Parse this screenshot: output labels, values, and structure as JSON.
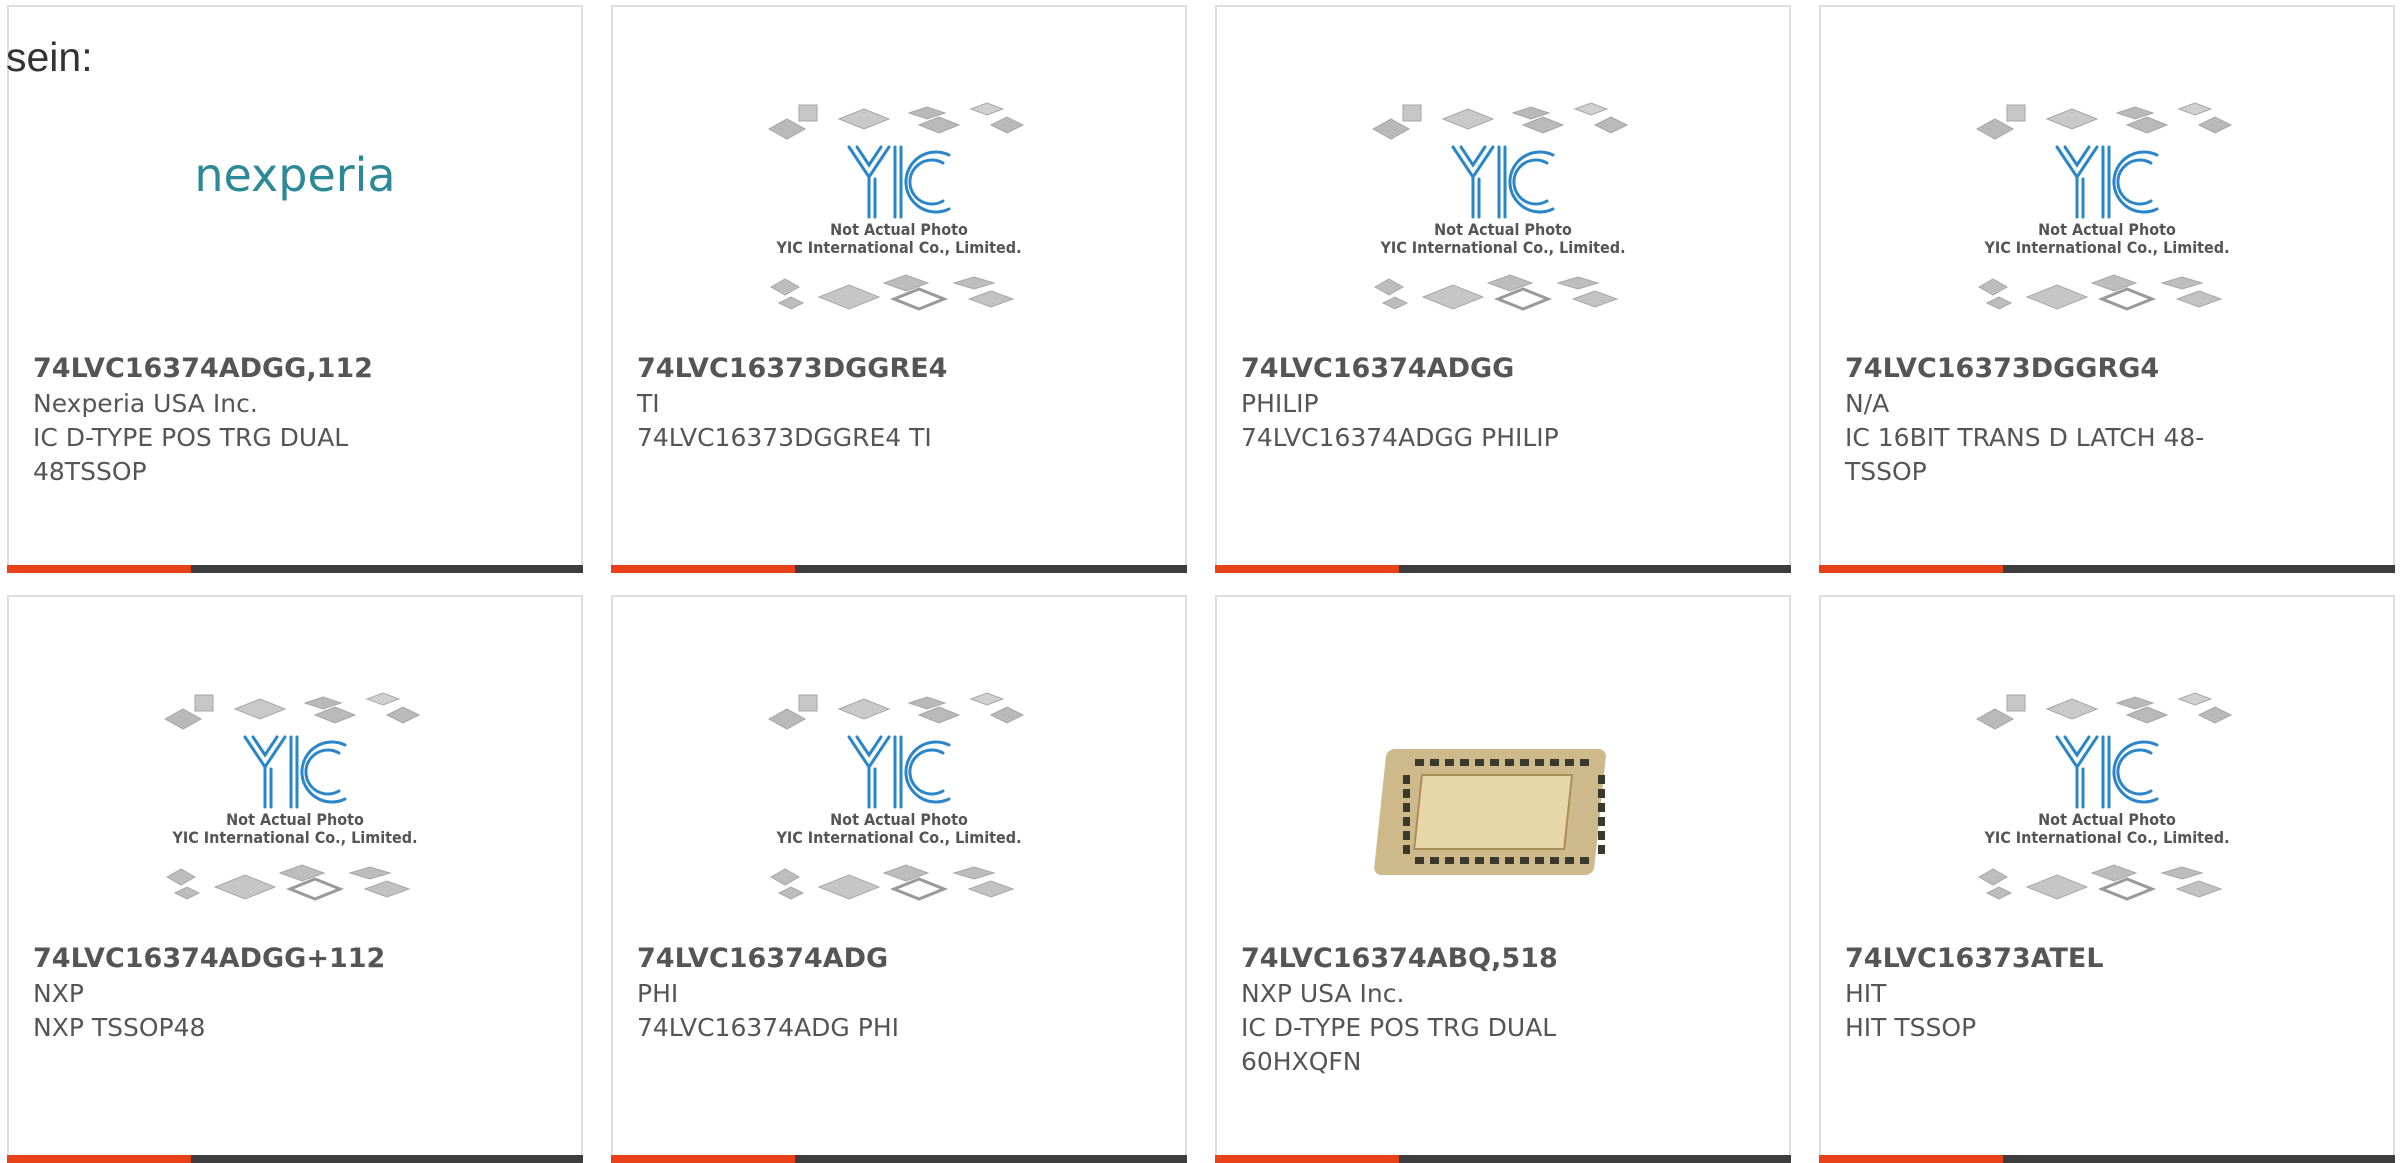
{
  "page": {
    "prefix_text": "sein:"
  },
  "placeholder": {
    "line1": "Not Actual Photo",
    "line2": "YIC International Co., Limited.",
    "logo": "YIC"
  },
  "products": [
    {
      "part_number": "74LVC16374ADGG,112",
      "manufacturer": "Nexperia USA Inc.",
      "description": "IC D-TYPE POS TRG DUAL 48TSSOP",
      "image": "nexperia-logo",
      "brand_text": "nexperia"
    },
    {
      "part_number": "74LVC16373DGGRE4",
      "manufacturer": "TI",
      "description": "74LVC16373DGGRE4 TI",
      "image": "yic-placeholder"
    },
    {
      "part_number": "74LVC16374ADGG",
      "manufacturer": "PHILIP",
      "description": "74LVC16374ADGG PHILIP",
      "image": "yic-placeholder"
    },
    {
      "part_number": "74LVC16373DGGRG4",
      "manufacturer": "N/A",
      "description": "IC 16BIT TRANS D LATCH 48-TSSOP",
      "image": "yic-placeholder"
    },
    {
      "part_number": "74LVC16374ADGG+112",
      "manufacturer": "NXP",
      "description": "NXP TSSOP48",
      "image": "yic-placeholder"
    },
    {
      "part_number": "74LVC16374ADG",
      "manufacturer": "PHI",
      "description": "74LVC16374ADG PHI",
      "image": "yic-placeholder"
    },
    {
      "part_number": "74LVC16374ABQ,518",
      "manufacturer": "NXP USA Inc.",
      "description": "IC D-TYPE POS TRG DUAL 60HXQFN",
      "image": "chip-photo"
    },
    {
      "part_number": "74LVC16373ATEL",
      "manufacturer": "HIT",
      "description": "HIT TSSOP",
      "image": "yic-placeholder"
    }
  ],
  "colors": {
    "accent": "#e8411a",
    "bar": "#3d3d3d",
    "border": "#dedede",
    "text": "#555555",
    "yic_blue": "#2a86c8",
    "nexperia_teal": "#2b8a96",
    "nexperia_orange": "#e8411a"
  }
}
